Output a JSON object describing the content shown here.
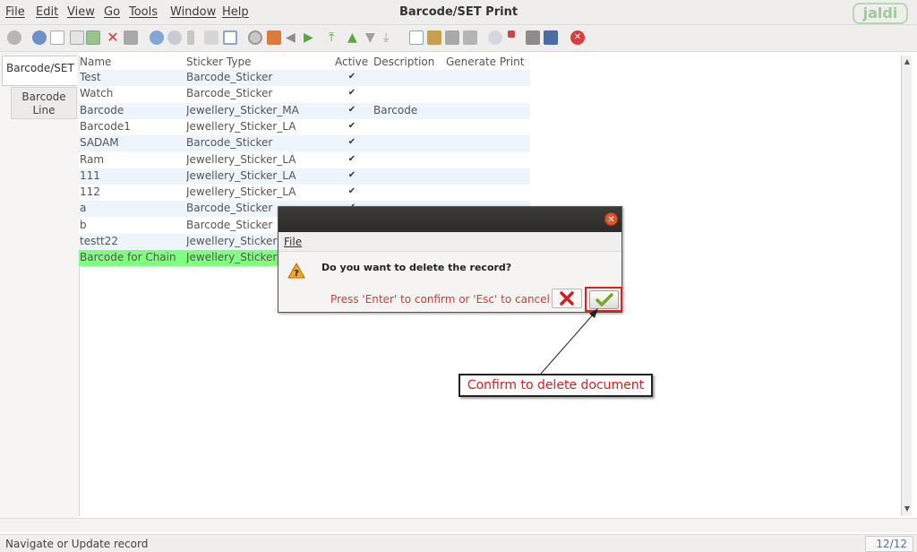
{
  "menu": {
    "items": [
      "File",
      "Edit",
      "View",
      "Go",
      "Tools",
      "Window",
      "Help"
    ],
    "title": "Barcode/SET Print"
  },
  "brand": {
    "logo_text": "jaldi"
  },
  "tabs": [
    {
      "label": "Barcode/SET"
    },
    {
      "label": "Barcode Line"
    }
  ],
  "grid": {
    "columns": [
      "Name",
      "Sticker Type",
      "Active",
      "Description",
      "Generate Print"
    ],
    "rows": [
      {
        "name": "Test",
        "sticker_type": "Barcode_Sticker",
        "active": true,
        "description": ""
      },
      {
        "name": "Watch",
        "sticker_type": "Barcode_Sticker",
        "active": true,
        "description": ""
      },
      {
        "name": "Barcode",
        "sticker_type": "Jewellery_Sticker_MA",
        "active": true,
        "description": "Barcode"
      },
      {
        "name": "Barcode1",
        "sticker_type": "Jewellery_Sticker_LA",
        "active": true,
        "description": ""
      },
      {
        "name": "SADAM",
        "sticker_type": "Barcode_Sticker",
        "active": true,
        "description": ""
      },
      {
        "name": "Ram",
        "sticker_type": "Jewellery_Sticker_LA",
        "active": true,
        "description": ""
      },
      {
        "name": "111",
        "sticker_type": "Jewellery_Sticker_LA",
        "active": true,
        "description": ""
      },
      {
        "name": "112",
        "sticker_type": "Jewellery_Sticker_LA",
        "active": true,
        "description": ""
      },
      {
        "name": "a",
        "sticker_type": "Barcode_Sticker",
        "active": true,
        "description": ""
      },
      {
        "name": "b",
        "sticker_type": "Barcode_Sticker",
        "active": true,
        "description": ""
      },
      {
        "name": "testt22",
        "sticker_type": "Jewellery_Sticker",
        "active": true,
        "description": ""
      },
      {
        "name": "Barcode for Chain",
        "sticker_type": "Jewellery_Sticker",
        "active": true,
        "description": ""
      }
    ],
    "selected_row": 11
  },
  "dialog": {
    "menu_file": "File",
    "question": "Do you want to delete the record?",
    "hint": "Press 'Enter' to confirm or 'Esc' to cancel",
    "close_icon": "close-icon",
    "cancel_icon": "x-icon",
    "ok_icon": "check-icon"
  },
  "annotation": {
    "text": "Confirm to delete document"
  },
  "status": {
    "text": "Navigate or Update record",
    "record_count": "12/12"
  },
  "colors": {
    "selected_row": "#80ff80",
    "annotation_text": "#e01b1b",
    "hint_text": "#d23b3b"
  }
}
